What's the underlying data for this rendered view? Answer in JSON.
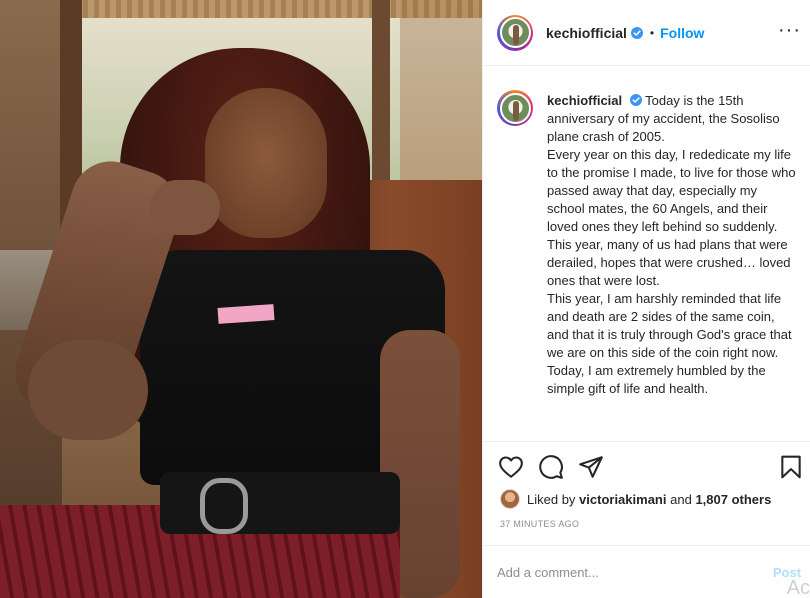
{
  "post": {
    "username": "kechiofficial",
    "dot": "•",
    "follow_label": "Follow",
    "more_label": "···",
    "caption_lines": [
      "Today is the 15th anniversary of my accident, the Sosoliso plane crash of 2005.",
      "Every year on this day, I rededicate my life to the promise I made, to live for those who passed away that day, especially my school mates, the 60 Angels, and their loved ones they left behind so suddenly.",
      "This year, many of us had plans that were derailed, hopes that were crushed… loved ones that were lost.",
      "This year, I am harshly reminded that life and death are 2 sides of the same coin, and that it is truly through God's grace that we are on this side of the coin right now.",
      "Today, I am extremely humbled by the simple gift of life and health."
    ],
    "likes": {
      "prefix": "Liked by",
      "liker": "victoriakimani",
      "and": "and",
      "others": "1,807 others"
    },
    "timestamp": "37 MINUTES AGO",
    "comment_placeholder": "Add a comment...",
    "post_label": "Post",
    "watermark": "Ac"
  },
  "icons": {
    "verified": "verified-badge-icon",
    "like": "heart-icon",
    "comment": "comment-bubble-icon",
    "share": "paper-plane-icon",
    "save": "bookmark-icon"
  },
  "colors": {
    "link_blue": "#0095f6",
    "verified_blue": "#3897f0",
    "post_disabled": "#b2dffc",
    "muted": "#8e8e8e",
    "border": "#efefef",
    "text": "#262626"
  }
}
